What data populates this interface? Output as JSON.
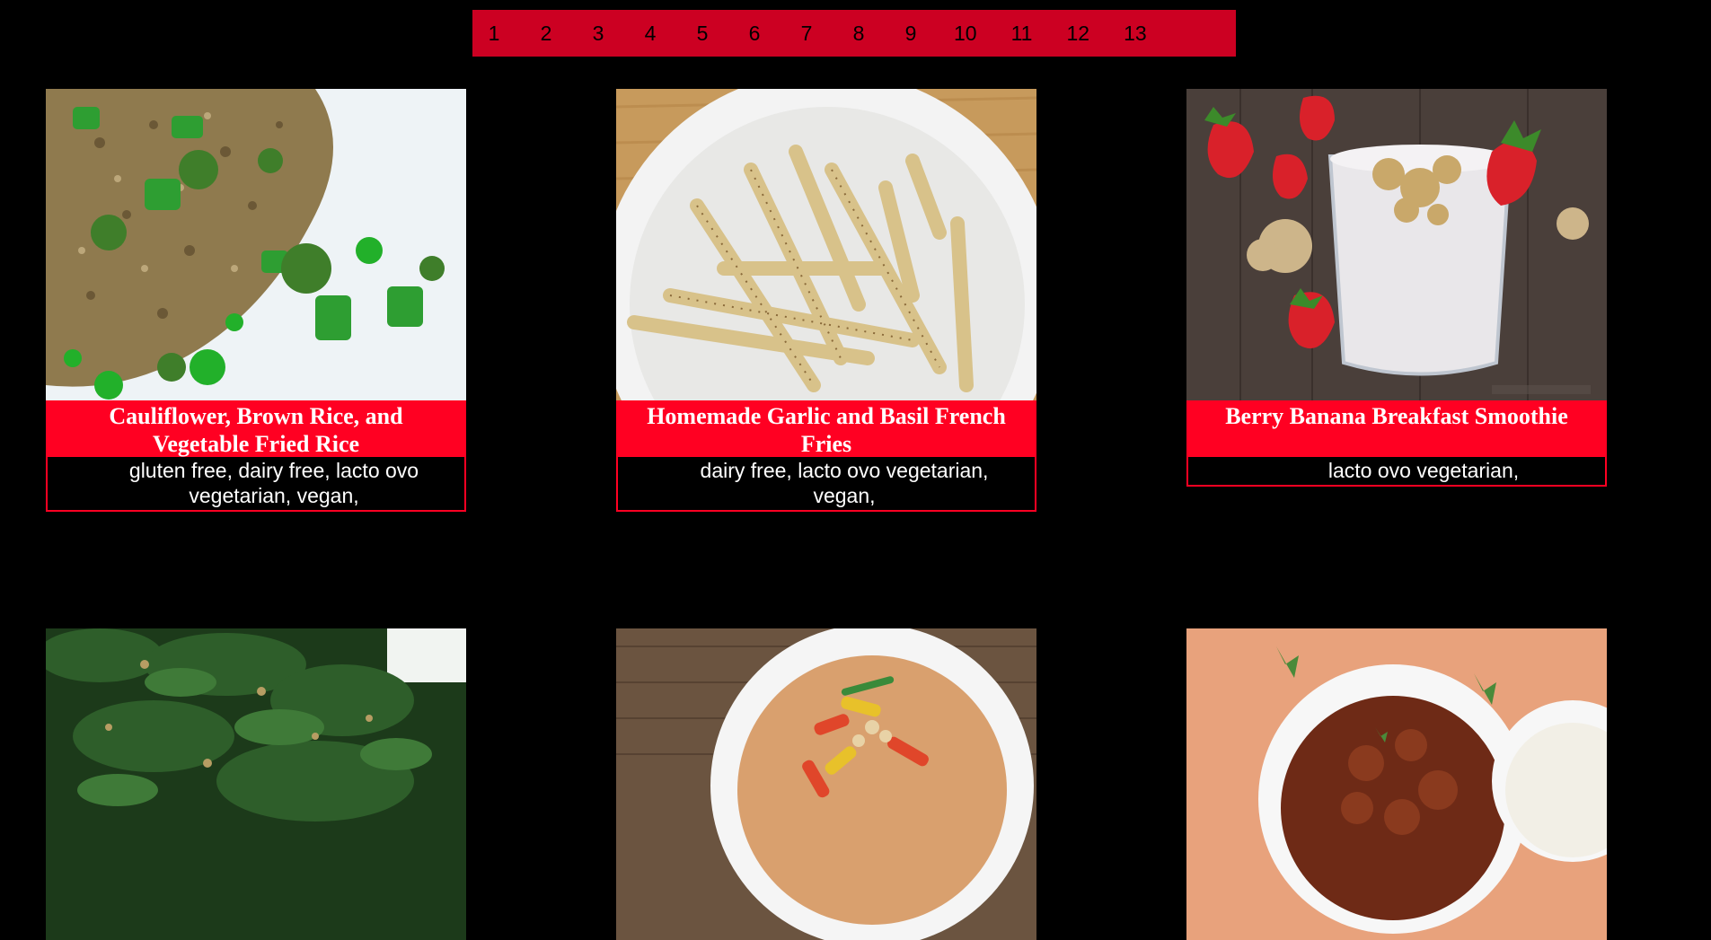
{
  "pagination": {
    "pages": [
      "1",
      "2",
      "3",
      "4",
      "5",
      "6",
      "7",
      "8",
      "9",
      "10",
      "11",
      "12",
      "13"
    ]
  },
  "recipes": [
    {
      "title": "Cauliflower, Brown Rice, and Vegetable Fried Rice",
      "tags": "gluten free, dairy free, lacto ovo vegetarian, vegan,",
      "image_icon": "fried-rice-photo"
    },
    {
      "title": "Homemade Garlic and Basil French Fries",
      "tags": "dairy free, lacto ovo vegetarian, vegan,",
      "image_icon": "french-fries-photo"
    },
    {
      "title": "Berry Banana Breakfast Smoothie",
      "tags": "lacto ovo vegetarian,",
      "image_icon": "smoothie-photo"
    },
    {
      "title": "",
      "tags": "",
      "image_icon": "kale-photo"
    },
    {
      "title": "",
      "tags": "",
      "image_icon": "curry-photo"
    },
    {
      "title": "",
      "tags": "",
      "image_icon": "stew-with-rice-photo"
    }
  ],
  "colors": {
    "accent": "#ff0022",
    "pagination_bg": "#cc0022",
    "background": "#000000"
  }
}
